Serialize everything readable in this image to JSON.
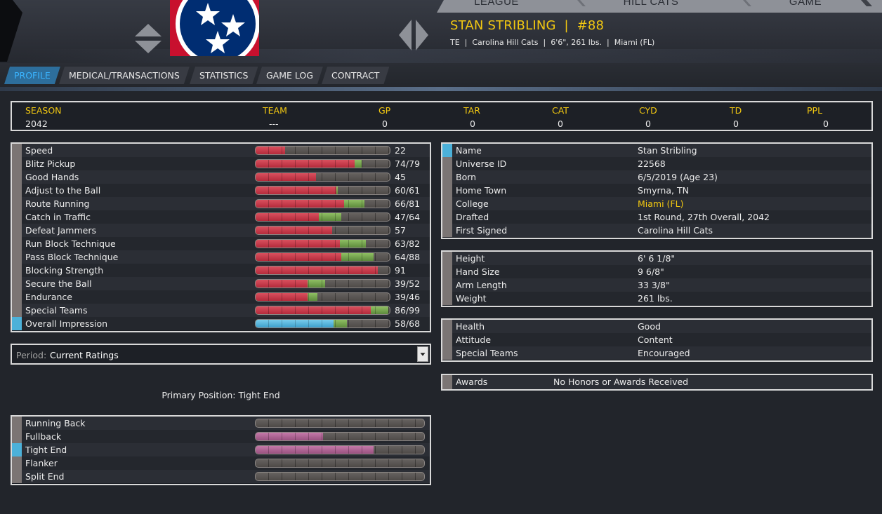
{
  "colors": {
    "accent_yellow": "#f2c811",
    "active_tab_blue": "#3ab4ff",
    "bar_red": "#c23445",
    "bar_green": "#6f9e49",
    "bar_blue": "#55b7e0",
    "bar_pink": "#b0689a",
    "panel_border": "#d9d9d9"
  },
  "header": {
    "nav": [
      "LEAGUE",
      "HILL CATS",
      "GAME"
    ],
    "player_name": "STAN STRIBLING  |  #88",
    "player_subline": "TE  |  Carolina Hill Cats  |  6'6\", 261 lbs.  |  Miami (FL)",
    "logo": "tennessee-tristar-logo"
  },
  "tabs": [
    "PROFILE",
    "MEDICAL/TRANSACTIONS",
    "STATISTICS",
    "GAME LOG",
    "CONTRACT"
  ],
  "active_tab": "PROFILE",
  "season_summary": {
    "headers": [
      "SEASON",
      "TEAM",
      "GP",
      "TAR",
      "CAT",
      "CYD",
      "TD",
      "PPL"
    ],
    "values": [
      "2042",
      "---",
      "0",
      "0",
      "0",
      "0",
      "0",
      "0"
    ]
  },
  "ratings": [
    {
      "name": "Speed",
      "text": "22",
      "current": 22,
      "potential": 22
    },
    {
      "name": "Blitz Pickup",
      "text": "74/79",
      "current": 74,
      "potential": 79
    },
    {
      "name": "Good Hands",
      "text": "45",
      "current": 45,
      "potential": 45
    },
    {
      "name": "Adjust to the Ball",
      "text": "60/61",
      "current": 60,
      "potential": 61
    },
    {
      "name": "Route Running",
      "text": "66/81",
      "current": 66,
      "potential": 81
    },
    {
      "name": "Catch in Traffic",
      "text": "47/64",
      "current": 47,
      "potential": 64
    },
    {
      "name": "Defeat Jammers",
      "text": "57",
      "current": 57,
      "potential": 57
    },
    {
      "name": "Run Block Technique",
      "text": "63/82",
      "current": 63,
      "potential": 82
    },
    {
      "name": "Pass Block Technique",
      "text": "64/88",
      "current": 64,
      "potential": 88
    },
    {
      "name": "Blocking Strength",
      "text": "91",
      "current": 91,
      "potential": 91
    },
    {
      "name": "Secure the Ball",
      "text": "39/52",
      "current": 39,
      "potential": 52
    },
    {
      "name": "Endurance",
      "text": "39/46",
      "current": 39,
      "potential": 46
    },
    {
      "name": "Special Teams",
      "text": "86/99",
      "current": 86,
      "potential": 99
    },
    {
      "name": "Overall Impression",
      "text": "58/68",
      "current": 58,
      "potential": 68,
      "highlight": true
    }
  ],
  "period": {
    "label": "Period:",
    "value": "Current Ratings"
  },
  "primary_position": "Primary Position: Tight End",
  "positions": [
    {
      "name": "Running Back",
      "fill": 0
    },
    {
      "name": "Fullback",
      "fill": 0.4
    },
    {
      "name": "Tight End",
      "fill": 0.7,
      "highlight": true
    },
    {
      "name": "Flanker",
      "fill": 0
    },
    {
      "name": "Split End",
      "fill": 0
    }
  ],
  "bio": [
    {
      "label": "Name",
      "value": "Stan Stribling"
    },
    {
      "label": "Universe ID",
      "value": "22568"
    },
    {
      "label": "Born",
      "value": "6/5/2019 (Age 23)"
    },
    {
      "label": "Home Town",
      "value": "Smyrna, TN"
    },
    {
      "label": "College",
      "value": "Miami (FL)",
      "link": true
    },
    {
      "label": "Drafted",
      "value": "1st Round, 27th Overall, 2042"
    },
    {
      "label": "First Signed",
      "value": "Carolina Hill Cats"
    }
  ],
  "body": [
    {
      "label": "Height",
      "value": "6' 6 1/8\""
    },
    {
      "label": "Hand Size",
      "value": "9 6/8\""
    },
    {
      "label": "Arm Length",
      "value": "33 3/8\""
    },
    {
      "label": "Weight",
      "value": "261 lbs."
    }
  ],
  "status": [
    {
      "label": "Health",
      "value": "Good"
    },
    {
      "label": "Attitude",
      "value": "Content"
    },
    {
      "label": "Special Teams",
      "value": "Encouraged"
    }
  ],
  "awards": {
    "label": "Awards",
    "value": "No Honors or Awards Received"
  }
}
